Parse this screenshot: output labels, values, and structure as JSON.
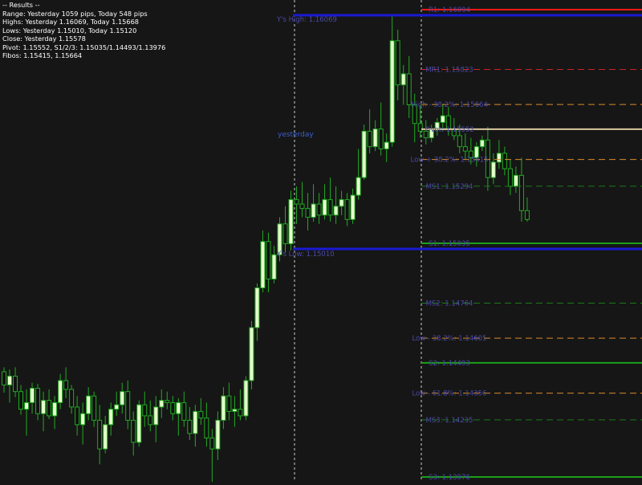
{
  "results": {
    "header": "-- Results --",
    "lines": [
      "Range: Yesterday 1059 pips, Today 548 pips",
      "Highs: Yesterday 1.16069, Today 1.15668",
      "Lows:  Yesterday 1.15010, Today 1.15120",
      "Close: Yesterday 1.15578",
      "Pivot: 1.15552, S1/2/3: 1.15035/1.14493/1.13976",
      "Fibos: 1.15415, 1.15664"
    ]
  },
  "markers": {
    "yesterday_label": "yesterday",
    "yesterday_high_label": "Y's High: 1.16069",
    "yesterday_low_label": "Y's Low: 1.15010"
  },
  "colors": {
    "background": "#161616",
    "bull_body": "#e6ffcc",
    "bear_body": "#111111",
    "wick": "#22aa22",
    "level_text": "#4a4aa8",
    "yesterday_text": "#3a5fcd"
  },
  "levels": [
    {
      "label": "R1: 1.16094",
      "price": 1.16094,
      "color": "#ff1a1a",
      "style": "solid"
    },
    {
      "label": "MR1: 1.15823",
      "price": 1.15823,
      "color": "#cc2222",
      "style": "dashed"
    },
    {
      "label": "High - 38.2%: 1.15664",
      "price": 1.15664,
      "color": "#d88a2a",
      "style": "dashed"
    },
    {
      "label": "Pivot: 1.15552",
      "price": 1.15552,
      "color": "#d9c9a0",
      "style": "solid"
    },
    {
      "label": "Low + 38.2%: 1.15415",
      "price": 1.15415,
      "color": "#d88a2a",
      "style": "dashed"
    },
    {
      "label": "MS1: 1.15294",
      "price": 1.15294,
      "color": "#1a7a1a",
      "style": "dashed"
    },
    {
      "label": "S1: 1.15035",
      "price": 1.15035,
      "color": "#1aa01a",
      "style": "solid"
    },
    {
      "label": "MS2: 1.14764",
      "price": 1.14764,
      "color": "#1a7a1a",
      "style": "dashed"
    },
    {
      "label": "Low - 38.2%: 1.14605",
      "price": 1.14605,
      "color": "#d88a2a",
      "style": "dashed"
    },
    {
      "label": "S2: 1.14493",
      "price": 1.14493,
      "color": "#1aa01a",
      "style": "solid"
    },
    {
      "label": "Low - 61.8%: 1.14356",
      "price": 1.14356,
      "color": "#d88a2a",
      "style": "dashed"
    },
    {
      "label": "MS3: 1.14235",
      "price": 1.14235,
      "color": "#1a7a1a",
      "style": "dashed"
    },
    {
      "label": "S3: 1.13976",
      "price": 1.13976,
      "color": "#1aa01a",
      "style": "solid"
    }
  ],
  "chart_data": {
    "type": "candlestick",
    "instrument_levels": {
      "yesterday_high": 1.16069,
      "yesterday_low": 1.1501,
      "today_high": 1.15668,
      "today_low": 1.1512
    },
    "candles": [
      [
        1.14453,
        1.14473,
        1.14358,
        1.14393
      ],
      [
        1.14393,
        1.14463,
        1.14313,
        1.14433
      ],
      [
        1.14433,
        1.14473,
        1.14338,
        1.14363
      ],
      [
        1.14363,
        1.14393,
        1.14258,
        1.14283
      ],
      [
        1.14283,
        1.14373,
        1.14163,
        1.14313
      ],
      [
        1.14313,
        1.14403,
        1.14263,
        1.14378
      ],
      [
        1.14378,
        1.14398,
        1.14233,
        1.14263
      ],
      [
        1.14263,
        1.14363,
        1.14183,
        1.14323
      ],
      [
        1.14323,
        1.14373,
        1.14238,
        1.14253
      ],
      [
        1.14253,
        1.14343,
        1.14193,
        1.14313
      ],
      [
        1.14313,
        1.14443,
        1.14283,
        1.14413
      ],
      [
        1.14413,
        1.14473,
        1.14333,
        1.14373
      ],
      [
        1.14373,
        1.14393,
        1.14263,
        1.14293
      ],
      [
        1.14293,
        1.14343,
        1.14163,
        1.14213
      ],
      [
        1.14213,
        1.14313,
        1.14123,
        1.14263
      ],
      [
        1.14263,
        1.14383,
        1.14233,
        1.14343
      ],
      [
        1.14343,
        1.14363,
        1.14203,
        1.14233
      ],
      [
        1.14233,
        1.14303,
        1.14033,
        1.14103
      ],
      [
        1.14103,
        1.14253,
        1.14083,
        1.14213
      ],
      [
        1.14213,
        1.14313,
        1.14163,
        1.14283
      ],
      [
        1.14283,
        1.14363,
        1.14253,
        1.14303
      ],
      [
        1.14303,
        1.14403,
        1.14263,
        1.14363
      ],
      [
        1.14363,
        1.14413,
        1.14193,
        1.14233
      ],
      [
        1.14233,
        1.14273,
        1.14073,
        1.14133
      ],
      [
        1.14133,
        1.14323,
        1.14113,
        1.14303
      ],
      [
        1.14303,
        1.14363,
        1.14203,
        1.14253
      ],
      [
        1.14253,
        1.14323,
        1.14183,
        1.14213
      ],
      [
        1.14213,
        1.14343,
        1.14133,
        1.14293
      ],
      [
        1.14293,
        1.14373,
        1.14243,
        1.14323
      ],
      [
        1.14323,
        1.14363,
        1.14283,
        1.14313
      ],
      [
        1.14313,
        1.14343,
        1.14233,
        1.14263
      ],
      [
        1.14263,
        1.14333,
        1.14163,
        1.14313
      ],
      [
        1.14313,
        1.14363,
        1.14203,
        1.14233
      ],
      [
        1.14233,
        1.14293,
        1.14143,
        1.14173
      ],
      [
        1.14173,
        1.14303,
        1.14113,
        1.14273
      ],
      [
        1.14273,
        1.14333,
        1.14213,
        1.14243
      ],
      [
        1.14243,
        1.14313,
        1.14113,
        1.14153
      ],
      [
        1.14153,
        1.14193,
        1.13863,
        1.14103
      ],
      [
        1.14103,
        1.14273,
        1.14053,
        1.14233
      ],
      [
        1.14233,
        1.14383,
        1.14193,
        1.14343
      ],
      [
        1.14343,
        1.14403,
        1.14233,
        1.14273
      ],
      [
        1.14273,
        1.14343,
        1.14203,
        1.14283
      ],
      [
        1.14283,
        1.14373,
        1.14233,
        1.14253
      ],
      [
        1.14253,
        1.14433,
        1.14233,
        1.14413
      ],
      [
        1.14413,
        1.14683,
        1.14373,
        1.14653
      ],
      [
        1.14653,
        1.14853,
        1.14593,
        1.14833
      ],
      [
        1.14833,
        1.15093,
        1.14813,
        1.15043
      ],
      [
        1.15043,
        1.15083,
        1.14813,
        1.14873
      ],
      [
        1.14873,
        1.15023,
        1.14853,
        1.14983
      ],
      [
        1.14983,
        1.15153,
        1.14953,
        1.15123
      ],
      [
        1.15123,
        1.15203,
        1.14993,
        1.15033
      ],
      [
        1.15033,
        1.15273,
        1.15003,
        1.15233
      ],
      [
        1.15233,
        1.15293,
        1.15123,
        1.15213
      ],
      [
        1.15213,
        1.15313,
        1.15153,
        1.15193
      ],
      [
        1.15193,
        1.15263,
        1.15093,
        1.15153
      ],
      [
        1.15153,
        1.15303,
        1.15133,
        1.15213
      ],
      [
        1.15213,
        1.15263,
        1.15123,
        1.15163
      ],
      [
        1.15163,
        1.15303,
        1.15143,
        1.15233
      ],
      [
        1.15233,
        1.15333,
        1.15133,
        1.15163
      ],
      [
        1.15163,
        1.15293,
        1.15123,
        1.15203
      ],
      [
        1.15203,
        1.15273,
        1.15163,
        1.15233
      ],
      [
        1.15233,
        1.15263,
        1.15113,
        1.15143
      ],
      [
        1.15143,
        1.15283,
        1.15123,
        1.15253
      ],
      [
        1.15253,
        1.15463,
        1.15233,
        1.15333
      ],
      [
        1.15333,
        1.15573,
        1.15323,
        1.15543
      ],
      [
        1.15543,
        1.15643,
        1.15443,
        1.15473
      ],
      [
        1.15473,
        1.15593,
        1.15453,
        1.15553
      ],
      [
        1.15553,
        1.15673,
        1.15433,
        1.15463
      ],
      [
        1.15463,
        1.15533,
        1.15403,
        1.15493
      ],
      [
        1.15493,
        1.16069,
        1.15473,
        1.15953
      ],
      [
        1.15953,
        1.16003,
        1.15683,
        1.15753
      ],
      [
        1.15753,
        1.15843,
        1.15663,
        1.15803
      ],
      [
        1.15803,
        1.15883,
        1.15603,
        1.15663
      ],
      [
        1.15663,
        1.15713,
        1.15493,
        1.15578
      ],
      [
        1.15578,
        1.15663,
        1.15513,
        1.15543
      ],
      [
        1.15543,
        1.15593,
        1.15483,
        1.15513
      ],
      [
        1.15513,
        1.15573,
        1.15493,
        1.15553
      ],
      [
        1.15553,
        1.15603,
        1.15523,
        1.15583
      ],
      [
        1.15583,
        1.15668,
        1.15543,
        1.15613
      ],
      [
        1.15613,
        1.15653,
        1.15523,
        1.15553
      ],
      [
        1.15553,
        1.15603,
        1.15503,
        1.15523
      ],
      [
        1.15523,
        1.15573,
        1.15443,
        1.15473
      ],
      [
        1.15473,
        1.15533,
        1.15413,
        1.15453
      ],
      [
        1.15453,
        1.15513,
        1.15393,
        1.15423
      ],
      [
        1.15423,
        1.15493,
        1.15383,
        1.15473
      ],
      [
        1.15473,
        1.15523,
        1.15453,
        1.15503
      ],
      [
        1.15503,
        1.15563,
        1.15273,
        1.15333
      ],
      [
        1.15333,
        1.15443,
        1.15303,
        1.15403
      ],
      [
        1.15403,
        1.15503,
        1.15373,
        1.15443
      ],
      [
        1.15443,
        1.15473,
        1.15343,
        1.15373
      ],
      [
        1.15373,
        1.15413,
        1.15253,
        1.15293
      ],
      [
        1.15293,
        1.15383,
        1.15263,
        1.15343
      ],
      [
        1.15343,
        1.15423,
        1.15133,
        1.15183
      ],
      [
        1.15183,
        1.15243,
        1.15133,
        1.15143
      ]
    ]
  }
}
